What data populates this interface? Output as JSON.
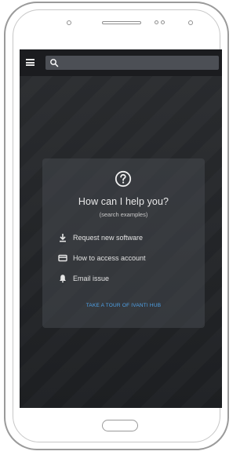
{
  "topbar": {
    "menu_icon": "hamburger-menu-icon",
    "search_icon": "search-icon",
    "search_placeholder": ""
  },
  "help_card": {
    "icon": "question-circle-icon",
    "title": "How can I help you?",
    "subtitle": "(search examples)",
    "examples": [
      {
        "icon": "download-icon",
        "label": "Request new software"
      },
      {
        "icon": "credit-card-icon",
        "label": "How to access account"
      },
      {
        "icon": "bell-icon",
        "label": "Email issue"
      }
    ],
    "tour_link": "TAKE A TOUR OF IVANTI HUB"
  },
  "colors": {
    "screen_bg": "#25272a",
    "topbar_bg": "#1b1c1f",
    "accent_link": "#4fa3ea",
    "text": "#e6e6e6"
  }
}
